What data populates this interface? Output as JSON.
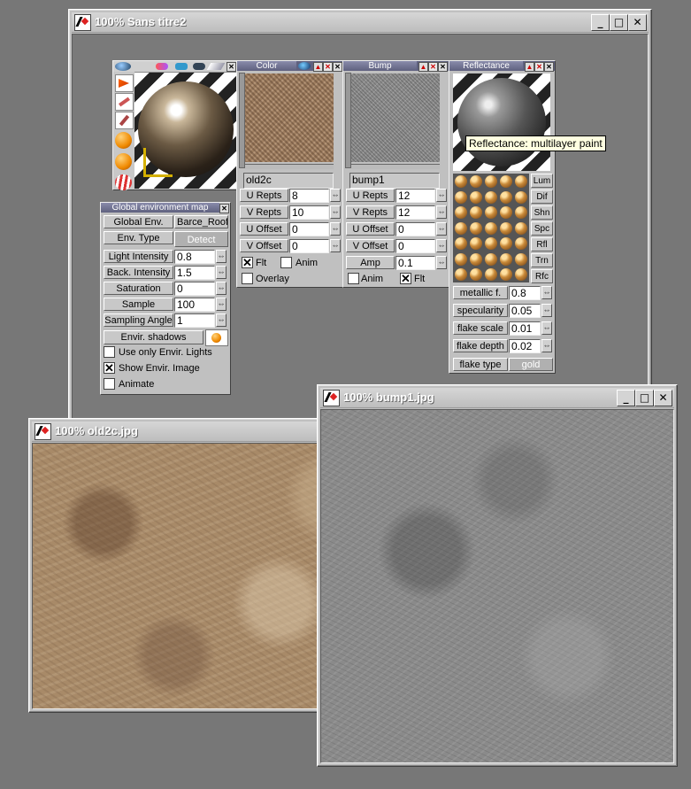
{
  "main_window": {
    "title": "100% Sans titre2"
  },
  "window_buttons": {
    "minimize": "_",
    "maximize": "□",
    "close": "✕"
  },
  "preview_panel": {
    "toolbar_icons": [
      "material-ball-icon",
      "paint-icon",
      "cube-icon",
      "glasses-icon",
      "brush-icon"
    ]
  },
  "color_panel": {
    "title": "Color",
    "texture_name": "old2c",
    "rows": [
      {
        "label": "U Repts",
        "value": "8"
      },
      {
        "label": "V Repts",
        "value": "10"
      },
      {
        "label": "U Offset",
        "value": "0"
      },
      {
        "label": "V Offset",
        "value": "0"
      }
    ],
    "flt": "Flt",
    "anim": "Anim",
    "overlay": "Overlay",
    "flt_checked": true,
    "anim_checked": false,
    "overlay_checked": false
  },
  "bump_panel": {
    "title": "Bump",
    "texture_name": "bump1",
    "rows": [
      {
        "label": "U Repts",
        "value": "12"
      },
      {
        "label": "V Repts",
        "value": "12"
      },
      {
        "label": "U Offset",
        "value": "0"
      },
      {
        "label": "V Offset",
        "value": "0"
      },
      {
        "label": "Amp",
        "value": "0.1"
      }
    ],
    "anim": "Anim",
    "flt": "Flt",
    "anim_checked": false,
    "flt_checked": true
  },
  "reflectance_panel": {
    "title": "Reflectance",
    "tooltip": "Reflectance: multilayer paint",
    "side_buttons": [
      "Lum",
      "Dif",
      "Shn",
      "Spc",
      "Rfl",
      "Trn",
      "Rfc"
    ],
    "rows": [
      {
        "label": "metallic f.",
        "value": "0.8"
      },
      {
        "label": "specularity",
        "value": "0.05"
      },
      {
        "label": "flake scale",
        "value": "0.01"
      },
      {
        "label": "flake depth",
        "value": "0.02"
      }
    ],
    "flake_type_label": "flake type",
    "flake_type_value": "gold"
  },
  "env_panel": {
    "title": "Global environment map",
    "global_env_label": "Global Env.",
    "global_env_value": "Barce_Rooft",
    "env_type_label": "Env. Type",
    "env_type_value": "Detect",
    "rows": [
      {
        "label": "Light Intensity",
        "value": "0.8"
      },
      {
        "label": "Back. Intensity",
        "value": "1.5"
      },
      {
        "label": "Saturation",
        "value": "0"
      },
      {
        "label": "Sample",
        "value": "100"
      },
      {
        "label": "Sampling Angle",
        "value": "1"
      }
    ],
    "shadows_label": "Envir. shadows",
    "checks": [
      {
        "label": "Use only Envir. Lights",
        "checked": false
      },
      {
        "label": "Show Envir. Image",
        "checked": true
      },
      {
        "label": "Animate",
        "checked": false
      }
    ]
  },
  "old2c_window": {
    "title": "100% old2c.jpg"
  },
  "bump1_window": {
    "title": "100% bump1.jpg"
  }
}
